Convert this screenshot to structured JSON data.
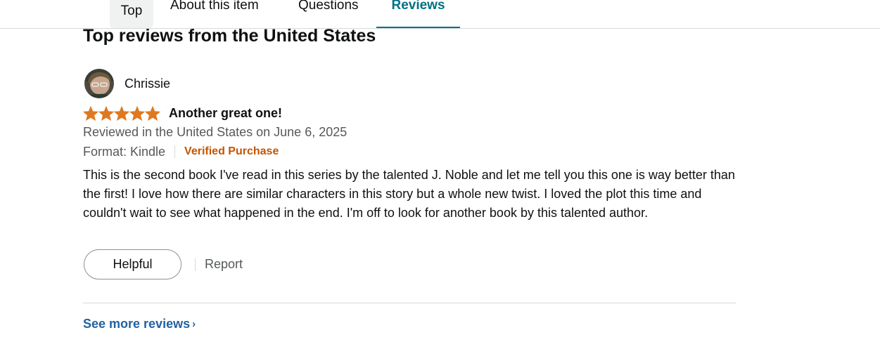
{
  "tabs": [
    {
      "label": "Top"
    },
    {
      "label": "About this item"
    },
    {
      "label": "Questions"
    },
    {
      "label": "Reviews"
    }
  ],
  "section": {
    "heading": "Top reviews from the United States"
  },
  "review": {
    "reviewer_name": "Chrissie",
    "avatar_icon": "user-avatar-photo",
    "rating_out_of_5": 5,
    "star_color": "#de7921",
    "title": "Another great one!",
    "date_line": "Reviewed in the United States on June 6, 2025",
    "format": "Format: Kindle",
    "verified": "Verified Purchase",
    "body": "This is the second book I've read in this series by the talented J. Noble and let me tell you this one is way better than the first! I love how there are similar characters in this story but a whole new twist. I loved the plot this time and couldn't wait to see what happened in the end. I'm off to look for another book by this talented author.",
    "helpful_label": "Helpful",
    "report_label": "Report"
  },
  "footer": {
    "see_more_label": "See more reviews",
    "chevron": "›"
  },
  "colors": {
    "accent": "#007185",
    "link": "#2162a1",
    "verified": "#c45500"
  }
}
